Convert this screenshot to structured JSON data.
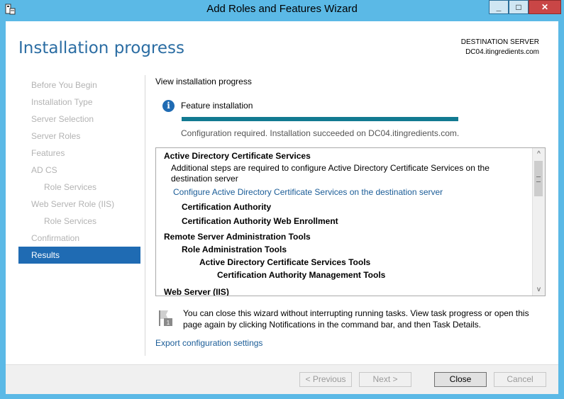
{
  "window": {
    "title": "Add Roles and Features Wizard",
    "min_glyph": "_",
    "max_glyph": "□",
    "close_glyph": "✕"
  },
  "header": {
    "title": "Installation progress",
    "dest_label": "DESTINATION SERVER",
    "dest_server": "DC04.itingredients.com"
  },
  "nav": {
    "items": [
      {
        "label": "Before You Begin",
        "level": 0,
        "active": false
      },
      {
        "label": "Installation Type",
        "level": 0,
        "active": false
      },
      {
        "label": "Server Selection",
        "level": 0,
        "active": false
      },
      {
        "label": "Server Roles",
        "level": 0,
        "active": false
      },
      {
        "label": "Features",
        "level": 0,
        "active": false
      },
      {
        "label": "AD CS",
        "level": 0,
        "active": false
      },
      {
        "label": "Role Services",
        "level": 1,
        "active": false
      },
      {
        "label": "Web Server Role (IIS)",
        "level": 0,
        "active": false
      },
      {
        "label": "Role Services",
        "level": 1,
        "active": false
      },
      {
        "label": "Confirmation",
        "level": 0,
        "active": false
      },
      {
        "label": "Results",
        "level": 0,
        "active": true
      }
    ]
  },
  "main": {
    "view_label": "View installation progress",
    "info_glyph": "i",
    "feature_label": "Feature installation",
    "progress_fraction": 1.0,
    "status": "Configuration required. Installation succeeded on DC04.itingredients.com.",
    "results": [
      {
        "text": "Active Directory Certificate Services",
        "style": "bold"
      },
      {
        "text": "Additional steps are required to configure Active Directory Certificate Services on the",
        "style": "normal"
      },
      {
        "text": "destination server",
        "style": "normal"
      },
      {
        "text": "Configure Active Directory Certificate Services on the destination server",
        "style": "link"
      },
      {
        "text": "Certification Authority",
        "style": "bold"
      },
      {
        "text": "Certification Authority Web Enrollment",
        "style": "bold"
      },
      {
        "text": "Remote Server Administration Tools",
        "style": "bold"
      },
      {
        "text": "Role Administration Tools",
        "style": "bold"
      },
      {
        "text": "Active Directory Certificate Services Tools",
        "style": "bold"
      },
      {
        "text": "Certification Authority Management Tools",
        "style": "bold"
      },
      {
        "text": "Web Server (IIS)",
        "style": "bold"
      }
    ],
    "scroll_up_glyph": "^",
    "scroll_down_glyph": "v",
    "flag_badge": "1",
    "close_note": "You can close this wizard without interrupting running tasks. View task progress or open this page again by clicking Notifications in the command bar, and then Task Details.",
    "export_link": "Export configuration settings"
  },
  "footer": {
    "previous": "< Previous",
    "next": "Next >",
    "close": "Close",
    "cancel": "Cancel"
  },
  "colors": {
    "accent": "#1f6bb3",
    "progress": "#127a91",
    "frame": "#5bb9e6"
  }
}
